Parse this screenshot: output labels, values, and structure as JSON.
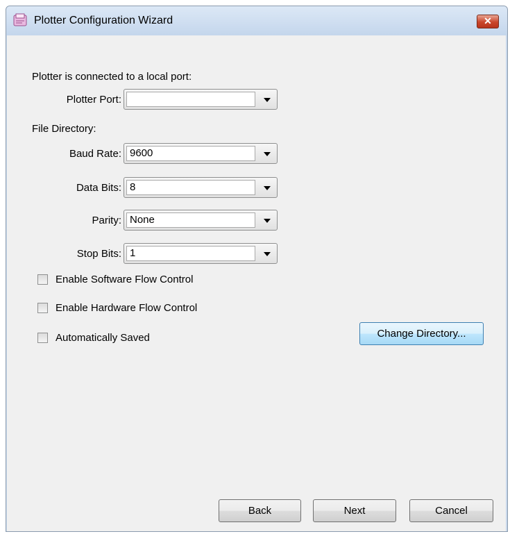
{
  "window": {
    "title": "Plotter Configuration Wizard",
    "close_glyph": "✕"
  },
  "form": {
    "connection_heading": "Plotter is connected to a local port:",
    "plotter_port": {
      "label": "Plotter Port:",
      "value": ""
    },
    "file_directory_label": "File Directory:",
    "baud_rate": {
      "label": "Baud Rate:",
      "value": "9600"
    },
    "data_bits": {
      "label": "Data Bits:",
      "value": "8"
    },
    "parity": {
      "label": "Parity:",
      "value": "None"
    },
    "stop_bits": {
      "label": "Stop Bits:",
      "value": "1"
    }
  },
  "checkboxes": {
    "software_flow": {
      "label": "Enable Software Flow Control",
      "checked": false
    },
    "hardware_flow": {
      "label": "Enable Hardware Flow Control",
      "checked": false
    },
    "auto_saved": {
      "label": "Automatically Saved",
      "checked": false
    }
  },
  "buttons": {
    "change_directory": "Change Directory...",
    "back": "Back",
    "next": "Next",
    "cancel": "Cancel"
  },
  "icons": {
    "app_icon": "plotter-app-icon",
    "close_icon": "close-icon",
    "dropdown_icon": "chevron-down-icon"
  },
  "colors": {
    "titlebar": "#c9d9ec",
    "client_background": "#f0f0f0",
    "close_button": "#c9452a",
    "focus_button": "#bee6fd"
  }
}
